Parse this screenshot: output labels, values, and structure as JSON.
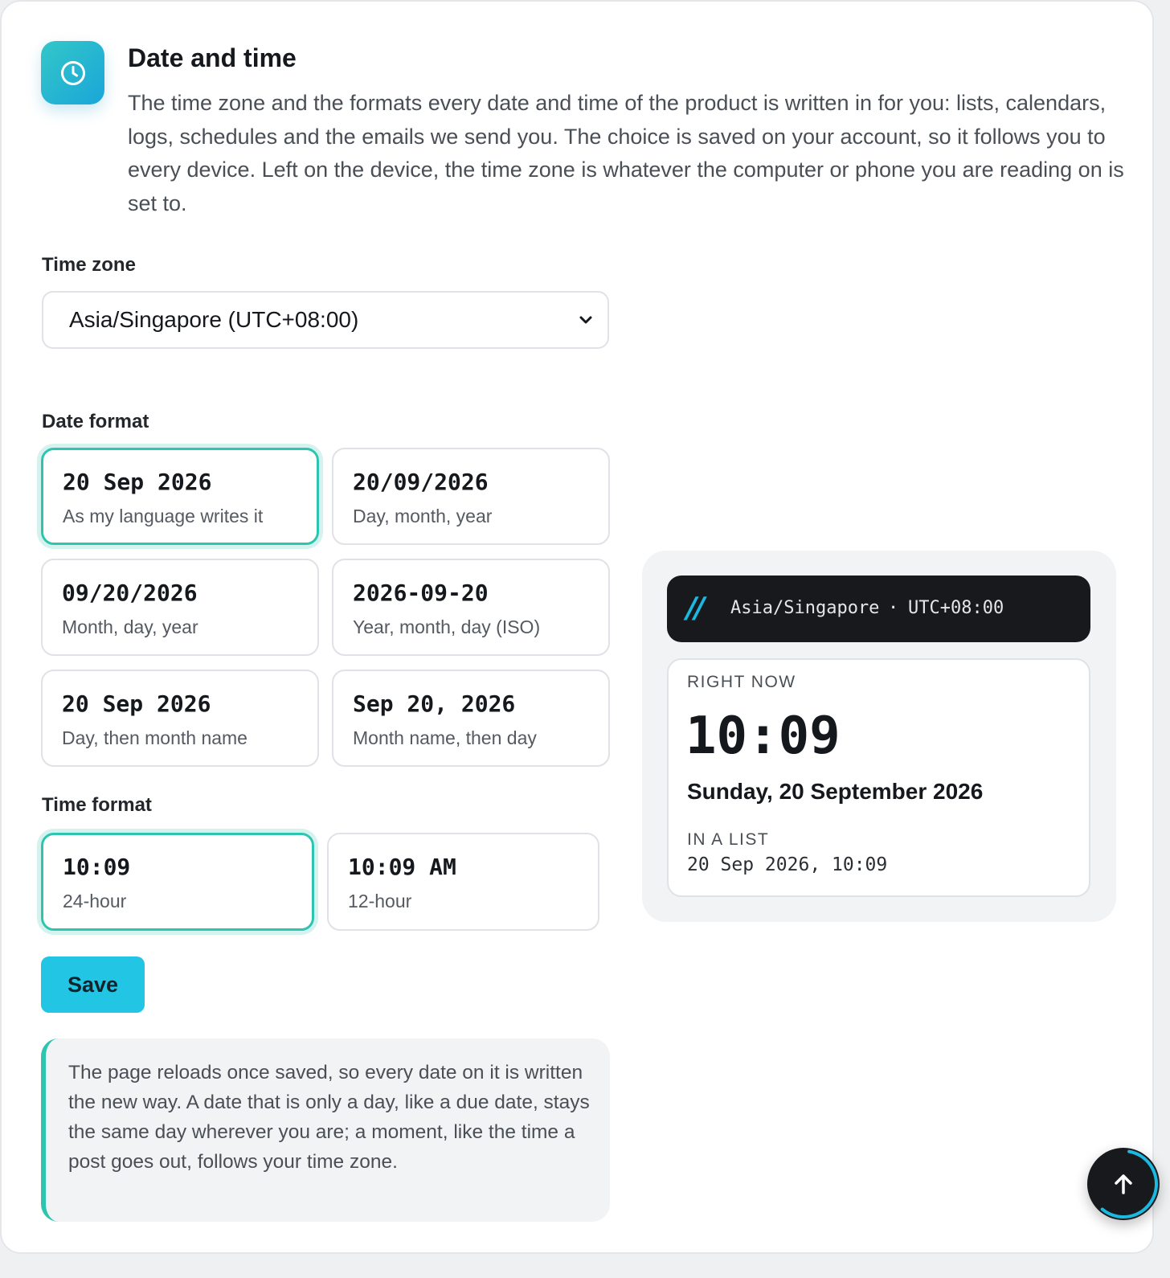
{
  "header": {
    "icon": "clock-icon",
    "title": "Date and time",
    "description": "The time zone and the formats every date and time of the product is written in for you: lists, calendars, logs, schedules and the emails we send you. The choice is saved on your account, so it follows you to every device. Left on the device, the time zone is whatever the computer or phone you are reading on is set to."
  },
  "timezone": {
    "label": "Time zone",
    "selected": "Asia/Singapore (UTC+08:00)"
  },
  "date_format": {
    "label": "Date format",
    "options": [
      {
        "sample": "20 Sep 2026",
        "description": "As my language writes it",
        "selected": true
      },
      {
        "sample": "20/09/2026",
        "description": "Day, month, year",
        "selected": false
      },
      {
        "sample": "09/20/2026",
        "description": "Month, day, year",
        "selected": false
      },
      {
        "sample": "2026-09-20",
        "description": "Year, month, day (ISO)",
        "selected": false
      },
      {
        "sample": "20 Sep 2026",
        "description": "Day, then month name",
        "selected": false
      },
      {
        "sample": "Sep 20, 2026",
        "description": "Month name, then day",
        "selected": false
      }
    ]
  },
  "time_format": {
    "label": "Time format",
    "options": [
      {
        "sample": "10:09",
        "description": "24-hour",
        "selected": true
      },
      {
        "sample": "10:09 AM",
        "description": "12-hour",
        "selected": false
      }
    ]
  },
  "save_label": "Save",
  "note": "The page reloads once saved, so every date on it is written the new way. A date that is only a day, like a due date, stays the same day wherever you are; a moment, like the time a post goes out, follows your time zone.",
  "preview": {
    "slashes": "//",
    "tz_name": "Asia/Singapore",
    "separator": "·",
    "tz_offset": "UTC+08:00",
    "now_caption": "RIGHT NOW",
    "time": "10:09",
    "date": "Sunday, 20 September 2026",
    "list_caption": "IN A LIST",
    "list_value": "20 Sep 2026, 10:09"
  },
  "scroll_top": {
    "icon": "arrow-up-icon"
  },
  "colors": {
    "accent": "#22c5e3",
    "selected_border": "#2fc4b0",
    "dark": "#17191c"
  }
}
